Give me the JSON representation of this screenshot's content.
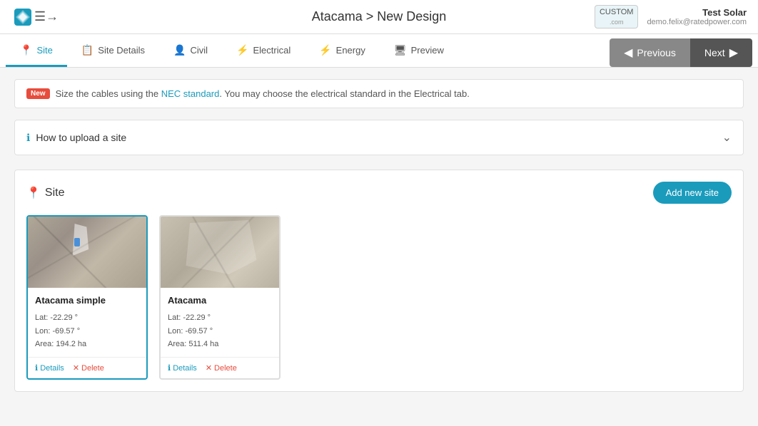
{
  "header": {
    "title": "Atacama > New Design",
    "custom_label": "CUSTOM",
    "custom_sublabel": ".com",
    "user_name": "Test Solar",
    "user_email": "demo.felix@ratedpower.com",
    "menu_icon": "≡→"
  },
  "nav": {
    "tabs": [
      {
        "id": "site",
        "label": "Site",
        "icon": "📍",
        "active": true
      },
      {
        "id": "site-details",
        "label": "Site Details",
        "icon": "📋",
        "active": false
      },
      {
        "id": "civil",
        "label": "Civil",
        "icon": "👤",
        "active": false
      },
      {
        "id": "electrical",
        "label": "Electrical",
        "icon": "⚡",
        "active": false
      },
      {
        "id": "energy",
        "label": "Energy",
        "icon": "⚡",
        "active": false
      },
      {
        "id": "preview",
        "label": "Preview",
        "icon": "🖥",
        "active": false
      }
    ],
    "prev_label": "Previous",
    "next_label": "Next"
  },
  "info_banner": {
    "new_badge": "New",
    "message": "Size the cables using the NEC standard. You may choose the electrical standard in the Electrical tab.",
    "link_text": "NEC standard"
  },
  "how_to": {
    "title": "How to upload a site",
    "info_icon": "ℹ"
  },
  "site_section": {
    "title": "Site",
    "pin_icon": "📍",
    "add_button_label": "Add new site",
    "cards": [
      {
        "id": "atacama-simple",
        "name": "Atacama simple",
        "lat": "Lat: -22.29 °",
        "lon": "Lon: -69.57 °",
        "area": "Area: 194.2 ha",
        "selected": true,
        "detail_label": "Details",
        "delete_label": "Delete"
      },
      {
        "id": "atacama",
        "name": "Atacama",
        "lat": "Lat: -22.29 °",
        "lon": "Lon: -69.57 °",
        "area": "Area: 511.4 ha",
        "selected": false,
        "detail_label": "Details",
        "delete_label": "Delete"
      }
    ]
  },
  "colors": {
    "accent": "#1a9bbc",
    "danger": "#e74c3c",
    "prev_btn": "#888888",
    "next_btn": "#555555"
  }
}
